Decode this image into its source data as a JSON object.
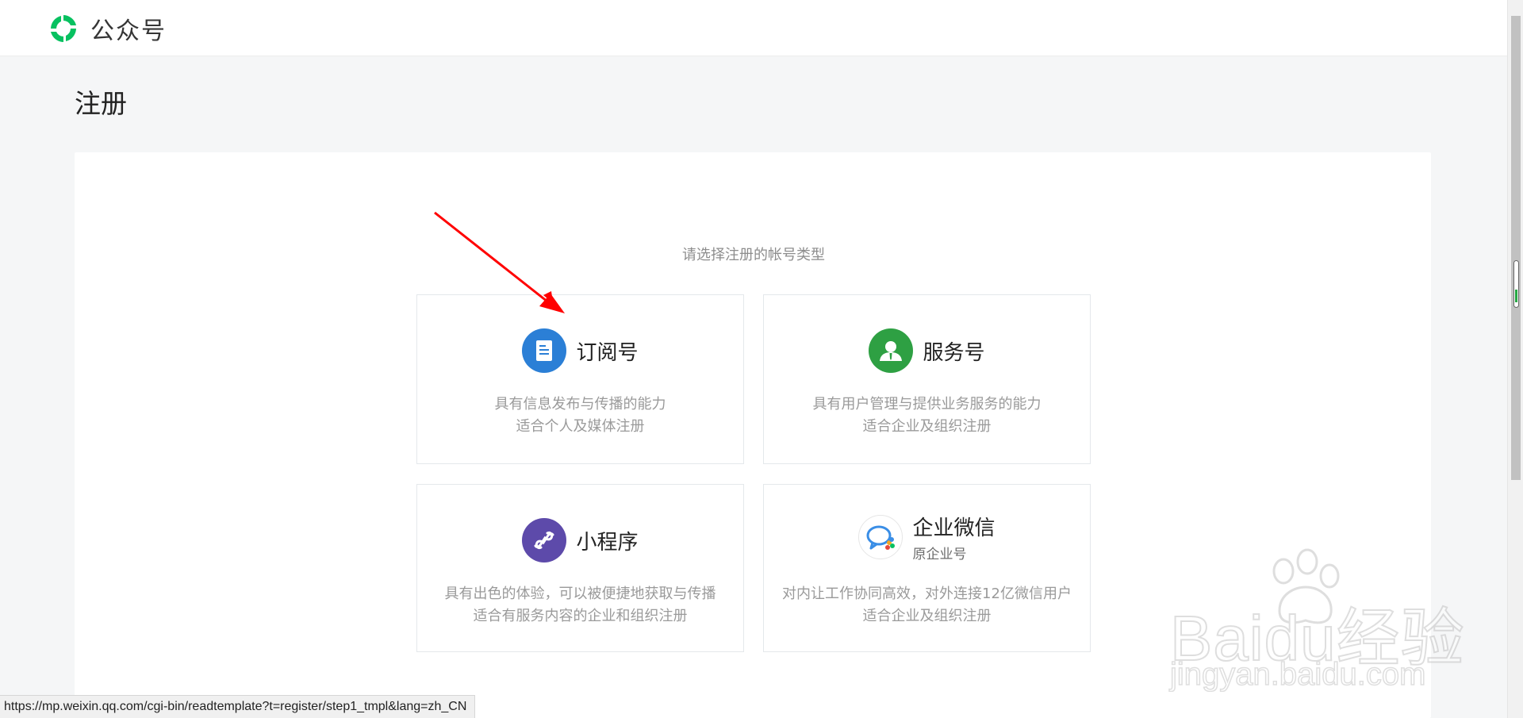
{
  "header": {
    "brand_name": "公众号"
  },
  "page": {
    "title": "注册",
    "hint": "请选择注册的帐号类型"
  },
  "cards": [
    {
      "title": "订阅号",
      "subtitle": "",
      "desc_line1": "具有信息发布与传播的能力",
      "desc_line2": "适合个人及媒体注册",
      "icon": "document-icon",
      "color": "#2b7fd6"
    },
    {
      "title": "服务号",
      "subtitle": "",
      "desc_line1": "具有用户管理与提供业务服务的能力",
      "desc_line2": "适合企业及组织注册",
      "icon": "person-icon",
      "color": "#2ea043"
    },
    {
      "title": "小程序",
      "subtitle": "",
      "desc_line1": "具有出色的体验，可以被便捷地获取与传播",
      "desc_line2": "适合有服务内容的企业和组织注册",
      "icon": "link-icon",
      "color": "#5d4aaa"
    },
    {
      "title": "企业微信",
      "subtitle": "原企业号",
      "desc_line1": "对内让工作协同高效，对外连接12亿微信用户",
      "desc_line2": "适合企业及组织注册",
      "icon": "chat-bubble-icon",
      "color": "#3a8ee6"
    }
  ],
  "statusbar": {
    "url": "https://mp.weixin.qq.com/cgi-bin/readtemplate?t=register/step1_tmpl&lang=zh_CN"
  },
  "watermark": {
    "main": "Baidu经验",
    "sub": "jingyan.baidu.com"
  },
  "colors": {
    "brand_green": "#07c160",
    "annotation_red": "#ff0000"
  }
}
